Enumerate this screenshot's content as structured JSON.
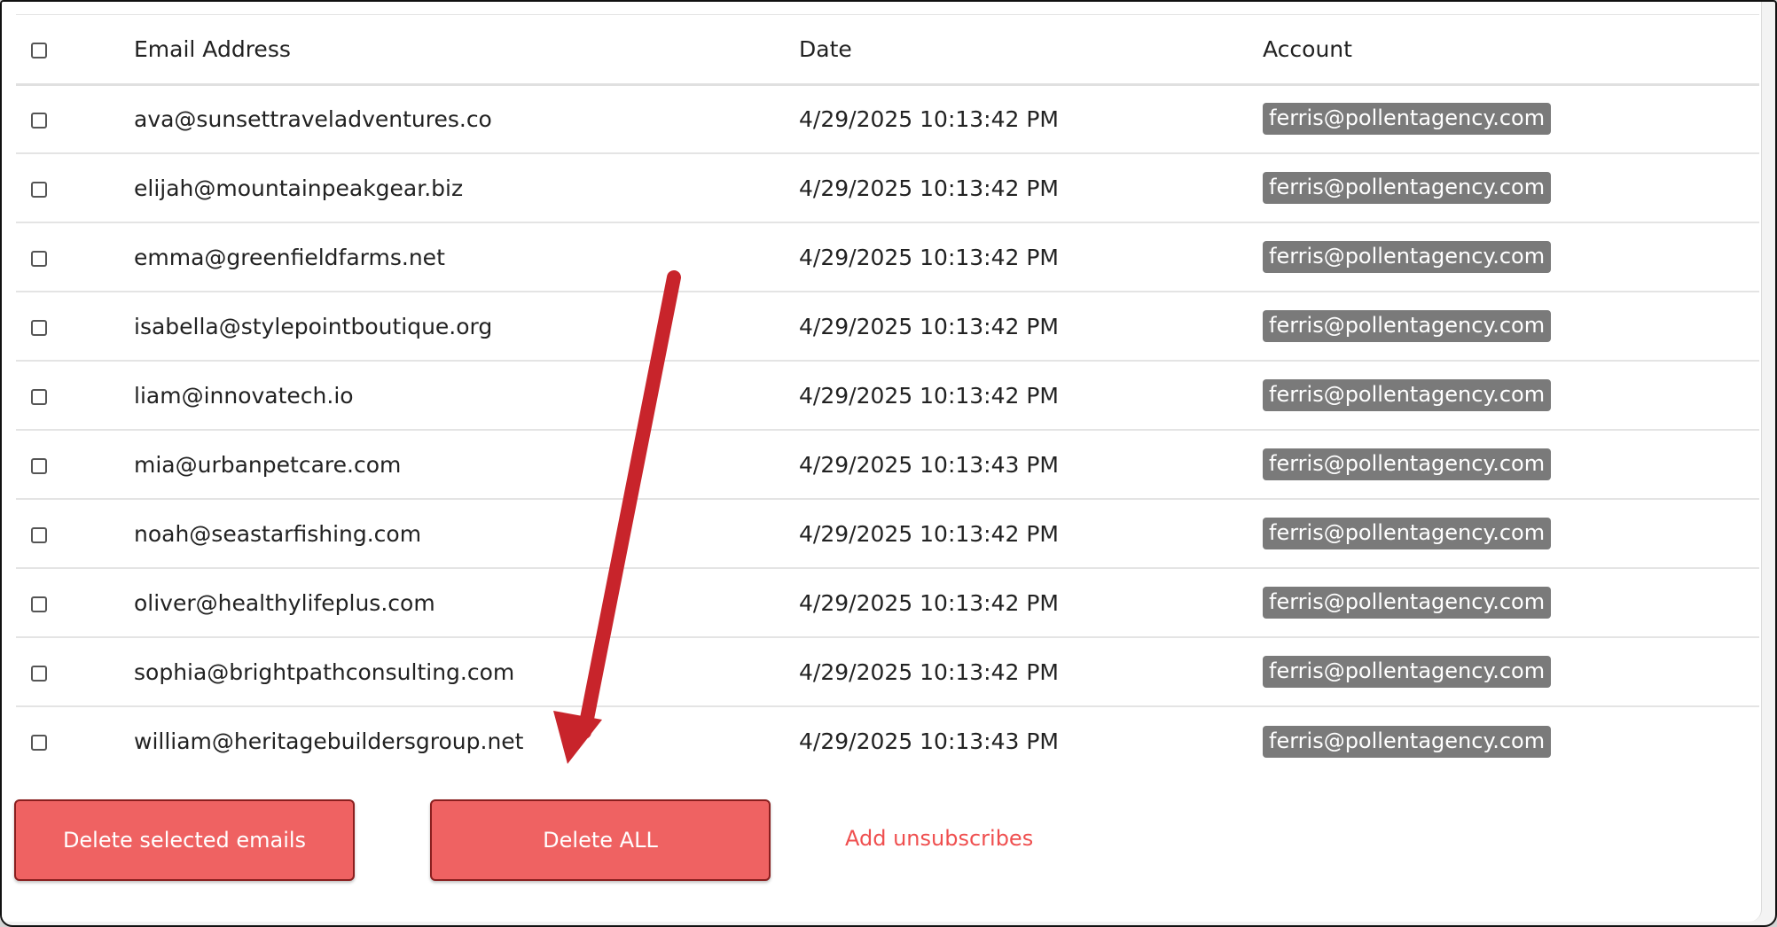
{
  "table": {
    "columns": [
      "Email Address",
      "Date",
      "Account"
    ],
    "rows": [
      {
        "email": "ava@sunsettraveladventures.co",
        "date": "4/29/2025 10:13:42 PM",
        "account": "ferris@pollentagency.com"
      },
      {
        "email": "elijah@mountainpeakgear.biz",
        "date": "4/29/2025 10:13:42 PM",
        "account": "ferris@pollentagency.com"
      },
      {
        "email": "emma@greenfieldfarms.net",
        "date": "4/29/2025 10:13:42 PM",
        "account": "ferris@pollentagency.com"
      },
      {
        "email": "isabella@stylepointboutique.org",
        "date": "4/29/2025 10:13:42 PM",
        "account": "ferris@pollentagency.com"
      },
      {
        "email": "liam@innovatech.io",
        "date": "4/29/2025 10:13:42 PM",
        "account": "ferris@pollentagency.com"
      },
      {
        "email": "mia@urbanpetcare.com",
        "date": "4/29/2025 10:13:43 PM",
        "account": "ferris@pollentagency.com"
      },
      {
        "email": "noah@seastarfishing.com",
        "date": "4/29/2025 10:13:42 PM",
        "account": "ferris@pollentagency.com"
      },
      {
        "email": "oliver@healthylifeplus.com",
        "date": "4/29/2025 10:13:42 PM",
        "account": "ferris@pollentagency.com"
      },
      {
        "email": "sophia@brightpathconsulting.com",
        "date": "4/29/2025 10:13:42 PM",
        "account": "ferris@pollentagency.com"
      },
      {
        "email": "william@heritagebuildersgroup.net",
        "date": "4/29/2025 10:13:43 PM",
        "account": "ferris@pollentagency.com"
      }
    ]
  },
  "actions": {
    "delete_selected": "Delete selected emails",
    "delete_all": "Delete ALL",
    "add_unsubscribes": "Add unsubscribes"
  },
  "annotation": {
    "arrow_color": "#c8242b"
  },
  "colors": {
    "button": "#ef6262",
    "link": "#ef4f4f",
    "badge": "#7a7a7a"
  }
}
